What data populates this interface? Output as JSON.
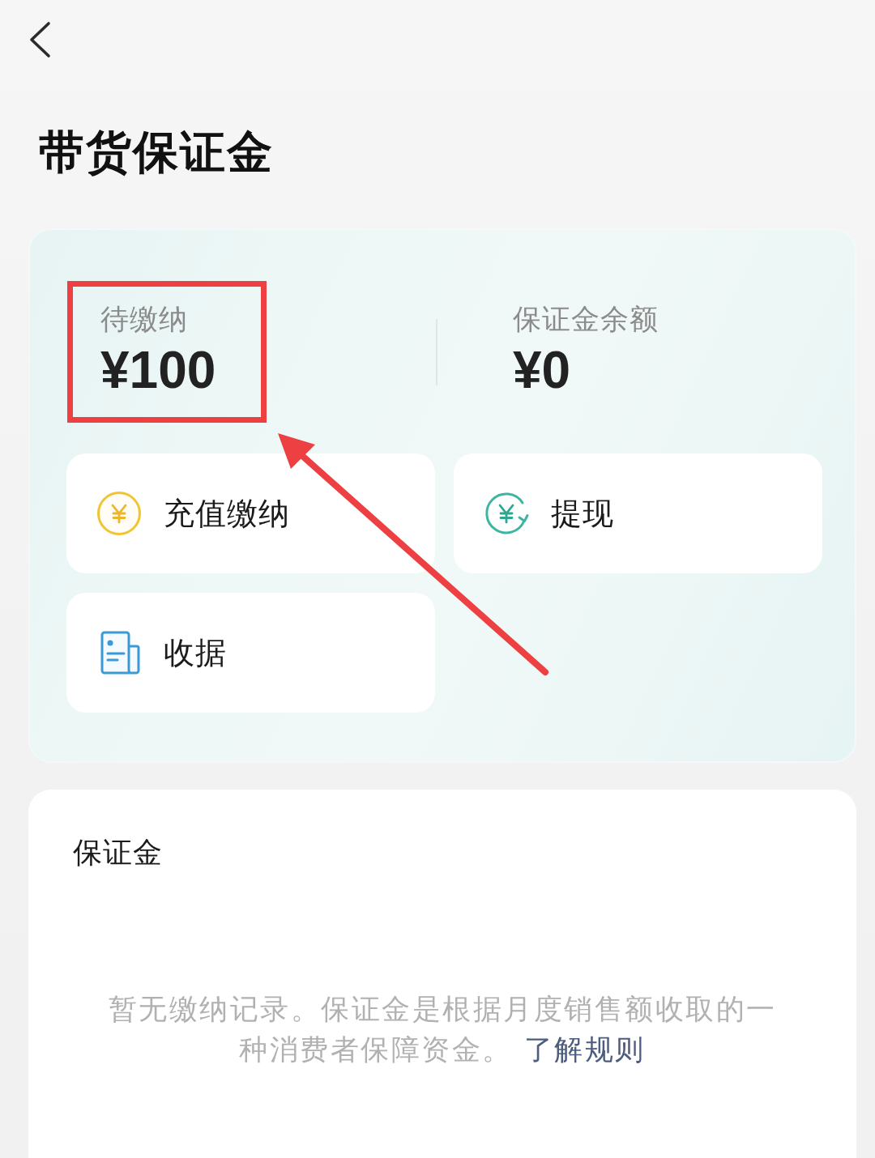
{
  "header": {
    "title": "带货保证金"
  },
  "summary": {
    "stats": [
      {
        "label": "待缴纳",
        "value": "¥100",
        "highlighted": true
      },
      {
        "label": "保证金余额",
        "value": "¥0",
        "highlighted": false
      }
    ],
    "actions": [
      {
        "kind": "recharge",
        "label": "充值缴纳"
      },
      {
        "kind": "withdraw",
        "label": "提现"
      },
      {
        "kind": "receipt",
        "label": "收据"
      }
    ]
  },
  "records": {
    "title": "保证金",
    "empty_text": "暂无缴纳记录。保证金是根据月度销售额收取的一种消费者保障资金。",
    "link": "了解规则"
  }
}
